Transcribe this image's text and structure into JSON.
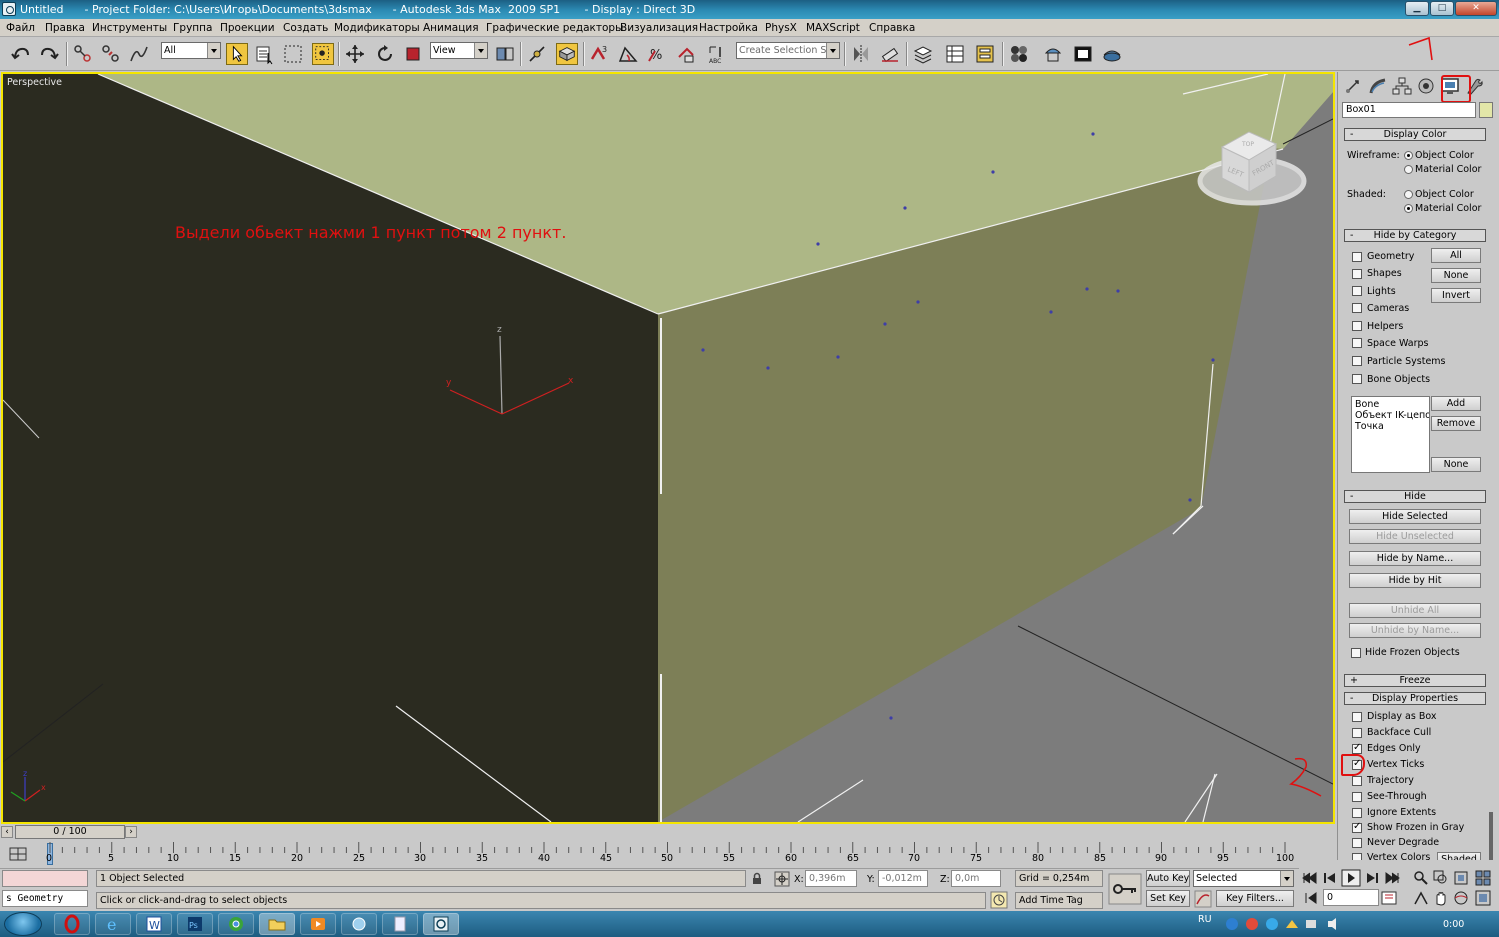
{
  "window": {
    "title": "Untitled      - Project Folder: C:\\Users\\Игорь\\Documents\\3dsmax      - Autodesk 3ds Max  2009 SP1       - Display : Direct 3D",
    "minimize": "▁",
    "maximize": "□",
    "close": "✕"
  },
  "menu": [
    "Файл",
    "Правка",
    "Инструменты",
    "Группа",
    "Проекции",
    "Создать",
    "Модификаторы",
    "Анимация",
    "Графические редакторы",
    "Визуализация",
    "Настройка",
    "PhysX",
    "MAXScript",
    "Справка"
  ],
  "toolbar": {
    "selection_filter": "All",
    "reference_coord": "View",
    "named_selection_placeholder": "Create Selection Set"
  },
  "viewport": {
    "label": "Perspective",
    "annotation": "Выдели обьект нажми 1 пункт потом 2 пункт.",
    "gizmo_axes": {
      "x": "x",
      "y": "y",
      "z": "z"
    },
    "viewcube": {
      "top": "TOP",
      "left": "LEFT",
      "front": "FRONT"
    },
    "marks": {
      "one": "1",
      "two": "2"
    },
    "colors": {
      "border_active": "#f4e500",
      "box_top": "#adb786",
      "box_right": "#7d7f57",
      "box_left": "#2b2b20",
      "ground": "#7c7c7c",
      "annotation": "#e01010"
    }
  },
  "command_panel": {
    "object_name": "Box01",
    "object_color": "#e2e6a8",
    "display_color": {
      "header": "Display Color",
      "wireframe_label": "Wireframe:",
      "shaded_label": "Shaded:",
      "object_color": "Object Color",
      "material_color": "Material Color",
      "wireframe_selected": "Object Color",
      "shaded_selected": "Material Color"
    },
    "hide_by_category": {
      "header": "Hide by Category",
      "items": [
        "Geometry",
        "Shapes",
        "Lights",
        "Cameras",
        "Helpers",
        "Space Warps",
        "Particle Systems",
        "Bone Objects"
      ],
      "btn_all": "All",
      "btn_none": "None",
      "btn_invert": "Invert",
      "list": [
        "Bone",
        "Объект IK-цепоч",
        "Точка"
      ],
      "btn_add": "Add",
      "btn_remove": "Remove",
      "btn_none2": "None"
    },
    "hide": {
      "header": "Hide",
      "hide_selected": "Hide Selected",
      "hide_unselected": "Hide Unselected",
      "hide_by_name": "Hide by Name...",
      "hide_by_hit": "Hide by Hit",
      "unhide_all": "Unhide All",
      "unhide_by_name": "Unhide by Name...",
      "hide_frozen": "Hide Frozen Objects"
    },
    "freeze": {
      "header": "Freeze"
    },
    "display_properties": {
      "header": "Display Properties",
      "items": [
        {
          "label": "Display as Box",
          "checked": false
        },
        {
          "label": "Backface Cull",
          "checked": false
        },
        {
          "label": "Edges Only",
          "checked": true
        },
        {
          "label": "Vertex Ticks",
          "checked": true
        },
        {
          "label": "Trajectory",
          "checked": false
        },
        {
          "label": "See-Through",
          "checked": false
        },
        {
          "label": "Ignore Extents",
          "checked": false
        },
        {
          "label": "Show Frozen in Gray",
          "checked": true
        },
        {
          "label": "Never Degrade",
          "checked": false
        },
        {
          "label": "Vertex Colors",
          "checked": false
        }
      ],
      "shaded_btn": "Shaded"
    }
  },
  "timeline": {
    "frame_display": "0 / 100",
    "ticks": [
      "0",
      "5",
      "10",
      "15",
      "20",
      "25",
      "30",
      "35",
      "40",
      "45",
      "50",
      "55",
      "60",
      "65",
      "70",
      "75",
      "80",
      "85",
      "90",
      "95",
      "100"
    ]
  },
  "status": {
    "maxscript": "s Geometry",
    "selection": "1 Object Selected",
    "prompt": "Click or click-and-drag to select objects",
    "x_label": "X:",
    "x_value": "0,396m",
    "y_label": "Y:",
    "y_value": "-0,012m",
    "z_label": "Z:",
    "z_value": "0,0m",
    "grid": "Grid = 0,254m",
    "add_time_tag": "Add Time Tag",
    "auto_key": "Auto Key",
    "set_key": "Set Key",
    "key_mode": "Selected",
    "key_filters": "Key Filters...",
    "current_frame": "0"
  },
  "taskbar": {
    "lang": "RU",
    "clock": "0:00"
  }
}
